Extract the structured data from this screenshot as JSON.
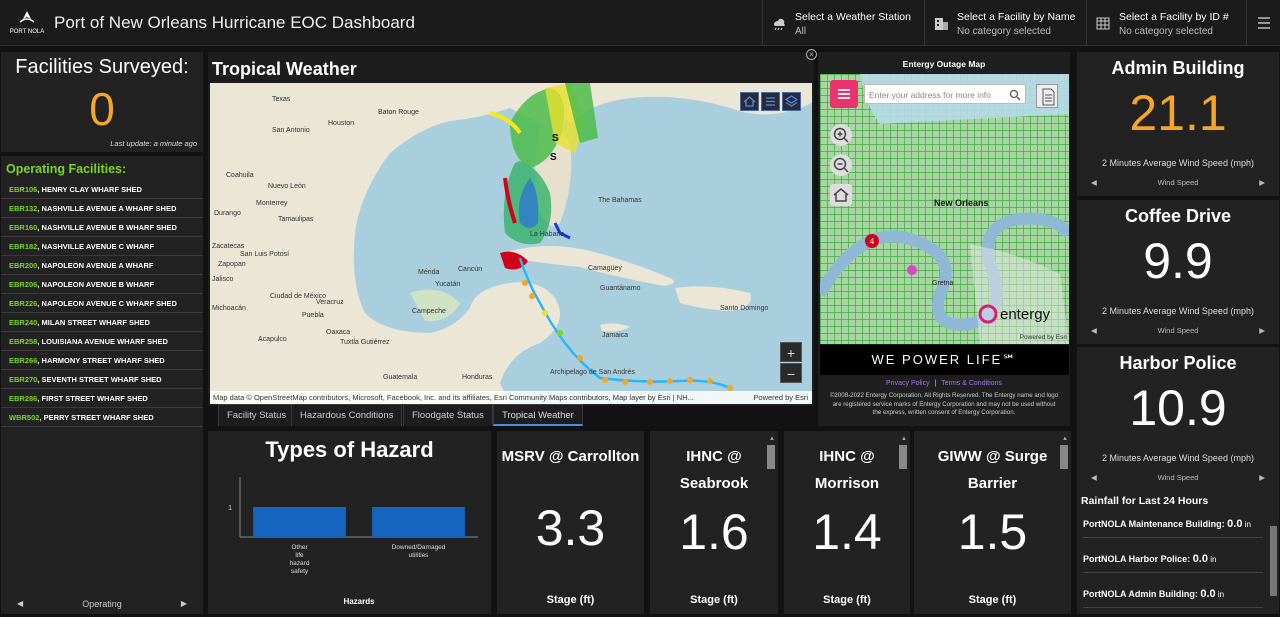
{
  "header": {
    "title": "Port of New Orleans Hurricane EOC Dashboard",
    "logo_text": "PORT NOLA",
    "selectors": [
      {
        "label": "Select a Weather Station",
        "value": "All"
      },
      {
        "label": "Select a Facility by Name",
        "value": "No category selected"
      },
      {
        "label": "Select a Facility by ID #",
        "value": "No category selected"
      }
    ]
  },
  "surveyed": {
    "title": "Facilities Surveyed:",
    "count": "0",
    "updated": "Last update: a minute ago"
  },
  "operating": {
    "title": "Operating Facilities:",
    "items": [
      {
        "id": "EBR106",
        "name": ", HENRY CLAY WHARF SHED"
      },
      {
        "id": "EBR132",
        "name": ", NASHVILLE AVENUE A WHARF SHED"
      },
      {
        "id": "EBR160",
        "name": ", NASHVILLE AVENUE B WHARF SHED"
      },
      {
        "id": "EBR182",
        "name": ", NASHVILLE AVENUE C WHARF"
      },
      {
        "id": "EBR200",
        "name": ", NAPOLEON AVENUE A WHARF"
      },
      {
        "id": "EBR206",
        "name": ", NAPOLEON AVENUE B WHARF"
      },
      {
        "id": "EBR226",
        "name": ", NAPOLEON AVENUE C WHARF SHED"
      },
      {
        "id": "EBR240",
        "name": ", MILAN STREET WHARF SHED"
      },
      {
        "id": "EBR258",
        "name": ", LOUISIANA AVENUE WHARF SHED"
      },
      {
        "id": "EBR266",
        "name": ", HARMONY STREET WHARF SHED"
      },
      {
        "id": "EBR270",
        "name": ", SEVENTH STREET WHARF SHED"
      },
      {
        "id": "EBR286",
        "name": ", FIRST STREET WHARF SHED"
      },
      {
        "id": "WBR502",
        "name": ", PERRY STREET WHARF SHED"
      }
    ],
    "footer": "Operating"
  },
  "weather": {
    "title": "Tropical Weather",
    "attribution": "Map data © OpenStreetMap contributors, Microsoft, Facebook, Inc. and its affiliates, Esri Community Maps contributors, Map layer by Esri | NH...",
    "powered": "Powered by Esri",
    "cities": [
      "Texas",
      "Baton Rouge",
      "Houston",
      "San Antonio",
      "Coahuila",
      "Nuevo León",
      "Monterrey",
      "Tamaulipas",
      "Durango",
      "Zacatecas",
      "San Luis Potosí",
      "Mérida",
      "Cancún",
      "Yucatán",
      "Ciudad de México",
      "Veracruz",
      "Campeche",
      "Jalisco",
      "Puebla",
      "Oaxaca",
      "Acapulco",
      "Tuxtla Gutiérrez",
      "Guatemala",
      "Honduras",
      "La Habana",
      "The Bahamas",
      "Camagüey",
      "Guantánamo",
      "Santo Domingo",
      "Jamaica",
      "Archipelago de San Andrés",
      "Michoacán",
      "Zapopan"
    ],
    "tabs": [
      "Facility Status",
      "Hazardous Conditions",
      "Floodgate Status",
      "Tropical Weather"
    ],
    "active_tab": "Tropical Weather"
  },
  "entergy": {
    "title": "Entergy Outage Map",
    "search_placeholder": "Enter your address for more info",
    "city_label": "New Orleans",
    "place_gretna": "Gretna",
    "brand": "entergy",
    "powered": "Powered by Esri",
    "badge": "4",
    "banner": "WE POWER LIFE℠",
    "privacy": "Privacy Policy",
    "sep": "|",
    "terms": "Terms & Conditions",
    "copyright": "©2008-2022 Entergy Corporation, All Rights Reserved. The Entergy name and logo are registered service marks of Entergy Corporation and may not be used without the express, written consent of Entergy Corporation."
  },
  "wind": [
    {
      "name": "Admin Building",
      "value": "21.1",
      "color": "#f5a623",
      "subtitle": "2 Minutes Average Wind Speed (mph)",
      "footer": "Wind Speed"
    },
    {
      "name": "Coffee Drive",
      "value": "9.9",
      "color": "#ffffff",
      "subtitle": "2 Minutes Average Wind Speed (mph)",
      "footer": "Wind Speed"
    },
    {
      "name": "Harbor Police",
      "value": "10.9",
      "color": "#ffffff",
      "subtitle": "2 Minutes Average Wind Speed (mph)",
      "footer": "Wind Speed"
    }
  ],
  "rain": {
    "title": "Rainfall for Last 24 Hours",
    "rows": [
      {
        "label": "PortNOLA Maintenance Building: ",
        "value": "0.0",
        "unit": " in"
      },
      {
        "label": "PortNOLA Harbor Police: ",
        "value": "0.0",
        "unit": " in"
      },
      {
        "label": "PortNOLA Admin Building: ",
        "value": "0.0",
        "unit": " in"
      }
    ]
  },
  "hazard": {
    "title": "Types of Hazard",
    "xlabel": "Hazards"
  },
  "chart_data": {
    "type": "bar",
    "title": "Types of Hazard",
    "categories": [
      "Other life hazard safety",
      "Downed/Damaged utilities"
    ],
    "values": [
      1,
      1
    ],
    "xlabel": "Hazards",
    "ylabel": "",
    "yticks": [
      1
    ],
    "ylim": [
      0,
      2
    ],
    "color": "#1565c0"
  },
  "stages": [
    {
      "name": "MSRV @ Carrollton",
      "value": "3.3",
      "unit": "Stage (ft)"
    },
    {
      "name": "IHNC @ Seabrook",
      "value": "1.6",
      "unit": "Stage (ft)"
    },
    {
      "name": "IHNC @ Morrison",
      "value": "1.4",
      "unit": "Stage (ft)"
    },
    {
      "name": "GIWW @ Surge Barrier",
      "value": "1.5",
      "unit": "Stage (ft)"
    }
  ]
}
